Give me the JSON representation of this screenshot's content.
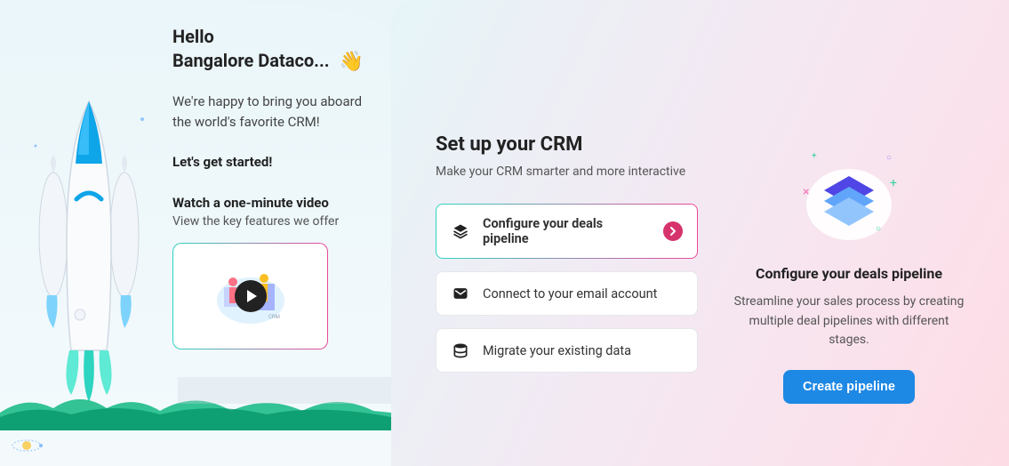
{
  "welcome": {
    "greeting_line1": "Hello",
    "greeting_line2": "Bangalore Dataco...",
    "wave_emoji": "👋",
    "intro": "We're happy to bring you aboard the world's favorite CRM!",
    "get_started": "Let's get started!",
    "watch_heading": "Watch a one-minute video",
    "watch_sub": "View the key features we offer"
  },
  "setup": {
    "title": "Set up your CRM",
    "subtitle": "Make your CRM smarter and more interactive",
    "options": [
      {
        "label": "Configure your deals pipeline",
        "icon": "layers-icon",
        "active": true
      },
      {
        "label": "Connect to your email account",
        "icon": "mail-icon",
        "active": false
      },
      {
        "label": "Migrate your existing data",
        "icon": "database-icon",
        "active": false
      }
    ]
  },
  "detail": {
    "title": "Configure your deals pipeline",
    "description": "Streamline your sales process by creating multiple deal pipelines with different stages.",
    "cta_label": "Create pipeline"
  },
  "colors": {
    "accent_blue": "#1e88e5",
    "accent_pink": "#d6336c",
    "gradient_start": "#2dd4bf",
    "gradient_end": "#ec4899"
  }
}
